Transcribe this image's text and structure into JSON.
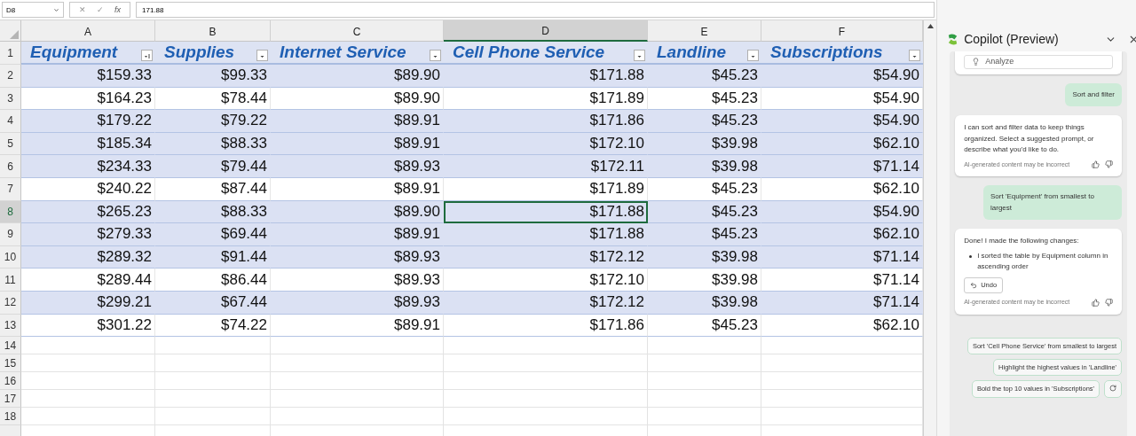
{
  "formula_bar": {
    "name_box": "D8",
    "cancel": "✕",
    "enter": "✓",
    "fx": "fx",
    "value": "171.88"
  },
  "columns": [
    {
      "letter": "A",
      "header": "Equipment",
      "sorted": true,
      "selected": false
    },
    {
      "letter": "B",
      "header": "Supplies",
      "sorted": false,
      "selected": false
    },
    {
      "letter": "C",
      "header": "Internet Service",
      "sorted": false,
      "selected": false
    },
    {
      "letter": "D",
      "header": "Cell Phone Service",
      "sorted": false,
      "selected": true
    },
    {
      "letter": "E",
      "header": "Landline",
      "sorted": false,
      "selected": false
    },
    {
      "letter": "F",
      "header": "Subscriptions",
      "sorted": false,
      "selected": false
    }
  ],
  "rows": [
    {
      "number": "2",
      "shaded": true,
      "selected": false,
      "cells": [
        "$159.33",
        "$99.33",
        "$89.90",
        "$171.88",
        "$45.23",
        "$54.90"
      ]
    },
    {
      "number": "3",
      "shaded": false,
      "selected": false,
      "cells": [
        "$164.23",
        "$78.44",
        "$89.90",
        "$171.89",
        "$45.23",
        "$54.90"
      ]
    },
    {
      "number": "4",
      "shaded": true,
      "selected": false,
      "cells": [
        "$179.22",
        "$79.22",
        "$89.91",
        "$171.86",
        "$45.23",
        "$54.90"
      ]
    },
    {
      "number": "5",
      "shaded": true,
      "selected": false,
      "cells": [
        "$185.34",
        "$88.33",
        "$89.91",
        "$172.10",
        "$39.98",
        "$62.10"
      ]
    },
    {
      "number": "6",
      "shaded": true,
      "selected": false,
      "cells": [
        "$234.33",
        "$79.44",
        "$89.93",
        "$172.11",
        "$39.98",
        "$71.14"
      ]
    },
    {
      "number": "7",
      "shaded": false,
      "selected": false,
      "cells": [
        "$240.22",
        "$87.44",
        "$89.91",
        "$171.89",
        "$45.23",
        "$62.10"
      ]
    },
    {
      "number": "8",
      "shaded": true,
      "selected": true,
      "cells": [
        "$265.23",
        "$88.33",
        "$89.90",
        "$171.88",
        "$45.23",
        "$54.90"
      ]
    },
    {
      "number": "9",
      "shaded": true,
      "selected": false,
      "cells": [
        "$279.33",
        "$69.44",
        "$89.91",
        "$171.88",
        "$45.23",
        "$62.10"
      ]
    },
    {
      "number": "10",
      "shaded": true,
      "selected": false,
      "cells": [
        "$289.32",
        "$91.44",
        "$89.93",
        "$172.12",
        "$39.98",
        "$71.14"
      ]
    },
    {
      "number": "11",
      "shaded": false,
      "selected": false,
      "cells": [
        "$289.44",
        "$86.44",
        "$89.93",
        "$172.10",
        "$39.98",
        "$71.14"
      ]
    },
    {
      "number": "12",
      "shaded": true,
      "selected": false,
      "cells": [
        "$299.21",
        "$67.44",
        "$89.93",
        "$172.12",
        "$39.98",
        "$71.14"
      ]
    },
    {
      "number": "13",
      "shaded": false,
      "selected": false,
      "cells": [
        "$301.22",
        "$74.22",
        "$89.91",
        "$171.86",
        "$45.23",
        "$62.10"
      ]
    }
  ],
  "header_row_number": "1",
  "empty_rows": [
    "14",
    "15",
    "16",
    "17",
    "18"
  ],
  "copilot": {
    "title": "Copilot (Preview)",
    "messages": [
      {
        "kind": "card",
        "text": "Analyze"
      },
      {
        "kind": "user",
        "text": "Sort and filter"
      },
      {
        "kind": "bot",
        "text": "I can sort and filter data to keep things organized. Select a suggested prompt, or describe what you'd like to do.",
        "disclaimer": "AI-generated content may be incorrect"
      },
      {
        "kind": "user",
        "text": "Sort 'Equipment' from smallest to largest"
      },
      {
        "kind": "bot",
        "text": "Done! I made the following changes:",
        "bullets": [
          "I sorted the table by Equipment column in ascending order"
        ],
        "action": "Undo",
        "disclaimer": "AI-generated content may be incorrect"
      }
    ],
    "suggestions": [
      "Sort 'Cell Phone Service' from smallest to largest",
      "Highlight the highest values in 'Landline'",
      "Bold the top 10 values in 'Subscriptions'"
    ]
  }
}
